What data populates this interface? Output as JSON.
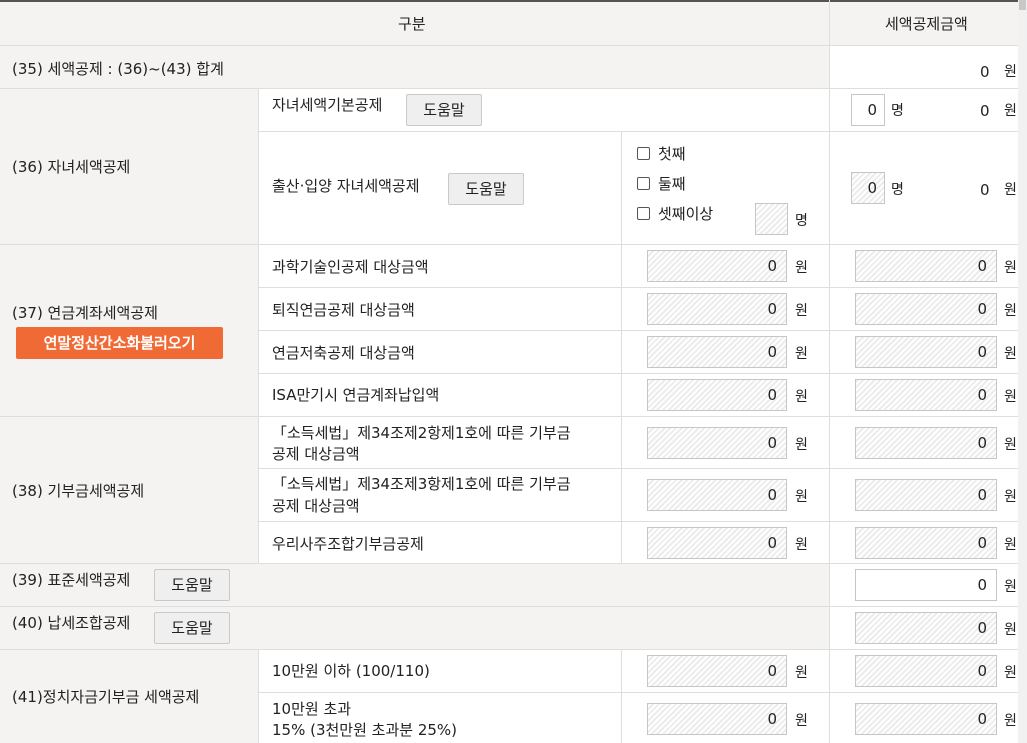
{
  "header": {
    "col_gubun": "구분",
    "col_amount": "세액공제금액"
  },
  "units": {
    "won": "원",
    "person": "명"
  },
  "help_label": "도움말",
  "rows": {
    "r35": {
      "label": "(35) 세액공제 : (36)~(43) 합계",
      "amount": "0"
    },
    "r36": {
      "label": "(36) 자녀세액공제",
      "basic": {
        "label": "자녀세액기본공제",
        "count": "0",
        "amount": "0"
      },
      "birth": {
        "label": "출산·입양 자녀세액공제",
        "checks": [
          "첫째",
          "둘째",
          "셋째이상"
        ],
        "third_count": "",
        "count": "0",
        "amount": "0"
      }
    },
    "r37": {
      "label": "(37) 연금계좌세액공제",
      "load_button": "연말정산간소화불러오기",
      "items": [
        {
          "label": "과학기술인공제 대상금액",
          "base": "0",
          "amount": "0"
        },
        {
          "label": "퇴직연금공제 대상금액",
          "base": "0",
          "amount": "0"
        },
        {
          "label": "연금저축공제 대상금액",
          "base": "0",
          "amount": "0"
        },
        {
          "label": "ISA만기시 연금계좌납입액",
          "base": "0",
          "amount": "0"
        }
      ]
    },
    "r38": {
      "label": "(38) 기부금세액공제",
      "items": [
        {
          "line1": "「소득세법」제34조제2항제1호에 따른 기부금",
          "line2": "공제 대상금액",
          "base": "0",
          "amount": "0"
        },
        {
          "line1": "「소득세법」제34조제3항제1호에 따른 기부금",
          "line2": "공제 대상금액",
          "base": "0",
          "amount": "0"
        },
        {
          "line1": "우리사주조합기부금공제",
          "line2": "",
          "base": "0",
          "amount": "0"
        }
      ]
    },
    "r39": {
      "label": "(39) 표준세액공제",
      "amount": "0"
    },
    "r40": {
      "label": "(40) 납세조합공제",
      "amount": "0"
    },
    "r41": {
      "label": "(41)정치자금기부금 세액공제",
      "items": [
        {
          "line1": "10만원 이하 (100/110)",
          "line2": "",
          "base": "0",
          "amount": "0"
        },
        {
          "line1": "10만원 초과",
          "line2": "15% (3천만원 초과분 25%)",
          "base": "0",
          "amount": "0"
        }
      ]
    }
  }
}
